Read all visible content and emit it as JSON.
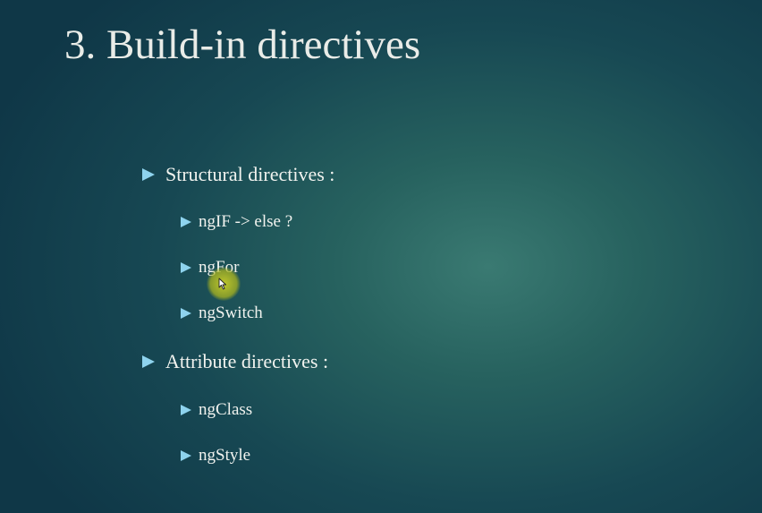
{
  "slide": {
    "title": "3. Build-in directives",
    "bullet_arrow_color": "#8ed3ee",
    "cursor_highlight_color": "#c8cd28",
    "sections": [
      {
        "label": "Structural directives :",
        "items": [
          "ngIF -> else ?",
          "ngFor",
          "ngSwitch"
        ]
      },
      {
        "label": "Attribute directives :",
        "items": [
          "ngClass",
          "ngStyle"
        ]
      }
    ]
  },
  "icons": {
    "bullet": "triangle-right-icon",
    "cursor": "mouse-pointer-icon"
  }
}
